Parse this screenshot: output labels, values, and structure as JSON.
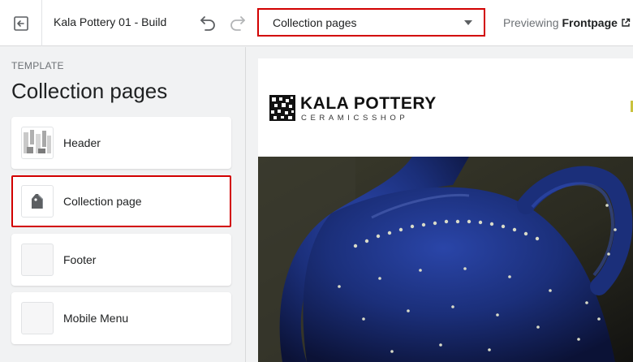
{
  "topbar": {
    "theme_title": "Kala Pottery 01 - Build",
    "template_select": "Collection pages",
    "preview_prefix": "Previewing",
    "preview_page": "Frontpage"
  },
  "sidebar": {
    "kicker": "TEMPLATE",
    "heading": "Collection pages",
    "sections": [
      {
        "label": "Header",
        "selected": false
      },
      {
        "label": "Collection page",
        "selected": true
      },
      {
        "label": "Footer",
        "selected": false
      },
      {
        "label": "Mobile Menu",
        "selected": false
      }
    ]
  },
  "store": {
    "logo_title": "KALA POTTERY",
    "logo_subtitle": "CERAMICSSHOP"
  },
  "colors": {
    "highlight": "#d20000",
    "jug_blue": "#1b2f7a",
    "accent": "#c9c23d"
  },
  "icons": [
    "exit-icon",
    "undo-icon",
    "redo-icon",
    "chevron-down-icon",
    "external-link-icon",
    "collection-tag-icon"
  ]
}
